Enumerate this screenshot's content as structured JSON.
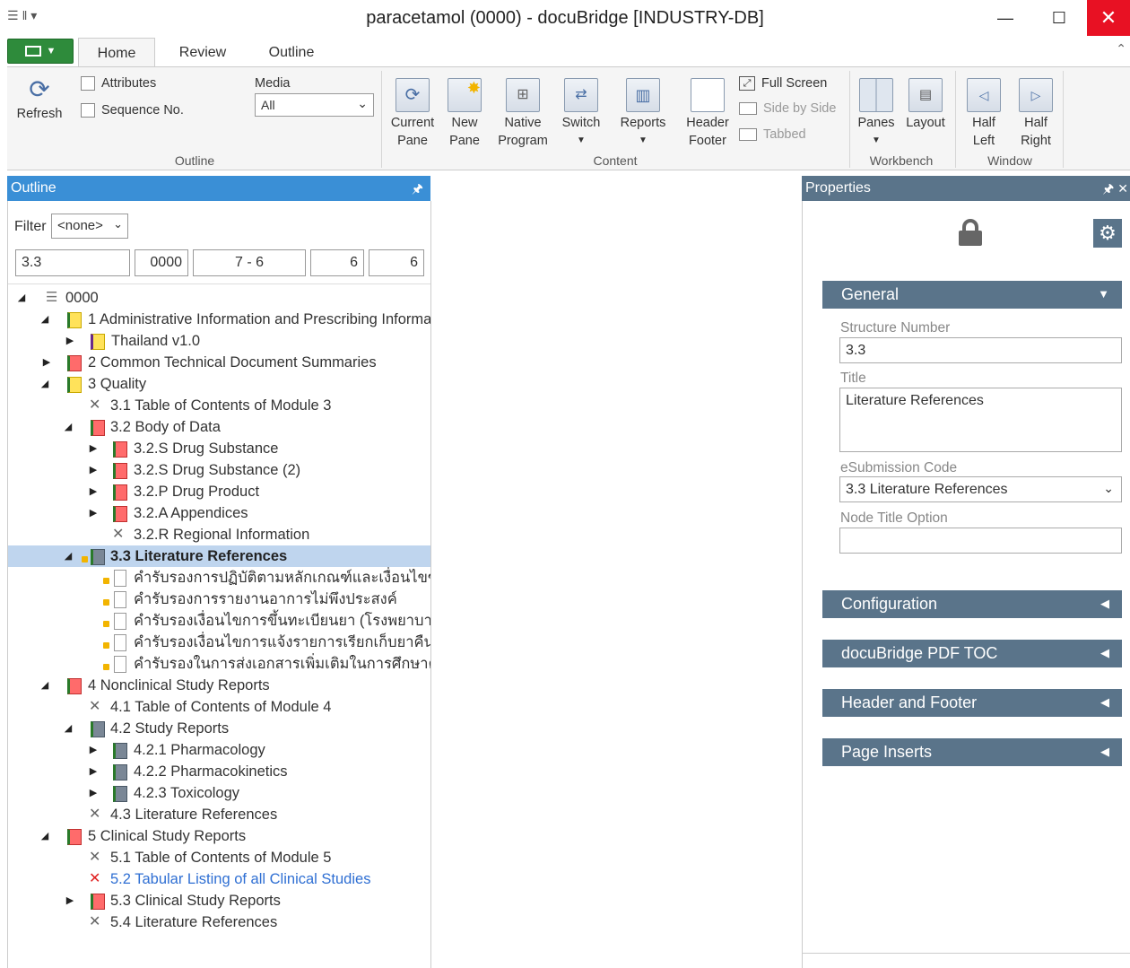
{
  "window": {
    "title": "paracetamol (0000) - docuBridge [INDUSTRY-DB]",
    "minimize": "—",
    "maximize": "☐",
    "close": "✕"
  },
  "ribbon": {
    "tabs": [
      "Home",
      "Review",
      "Outline"
    ],
    "outline_group": {
      "refresh": "Refresh",
      "attributes": "Attributes",
      "sequence_no": "Sequence No.",
      "media_label": "Media",
      "media_value": "All",
      "label": "Outline"
    },
    "content_group": {
      "current_pane": [
        "Current",
        "Pane"
      ],
      "new_pane": [
        "New",
        "Pane"
      ],
      "native_program": [
        "Native",
        "Program"
      ],
      "switch": "Switch",
      "reports": "Reports",
      "header_footer": [
        "Header",
        "Footer"
      ],
      "full_screen": "Full Screen",
      "side_by_side": "Side by Side",
      "tabbed": "Tabbed",
      "label": "Content"
    },
    "workbench_group": {
      "panes": "Panes",
      "layout": "Layout",
      "label": "Workbench"
    },
    "window_group": {
      "half_left": [
        "Half",
        "Left"
      ],
      "half_right": [
        "Half",
        "Right"
      ],
      "label": "Window"
    }
  },
  "outline": {
    "title": "Outline",
    "pin": "🖈",
    "filter_label": "Filter",
    "filter_value": "<none>",
    "seq_fields": [
      "3.3",
      "0000",
      "7 - 6",
      "6",
      "6"
    ],
    "tree": [
      {
        "label": "0000"
      },
      {
        "label": "1 Administrative Information and Prescribing Informa"
      },
      {
        "label": "Thailand v1.0"
      },
      {
        "label": "2 Common Technical Document Summaries"
      },
      {
        "label": "3 Quality"
      },
      {
        "label": "3.1 Table of Contents of Module 3"
      },
      {
        "label": "3.2 Body of Data"
      },
      {
        "label": "3.2.S Drug Substance"
      },
      {
        "label": "3.2.S Drug Substance (2)"
      },
      {
        "label": "3.2.P Drug Product"
      },
      {
        "label": "3.2.A Appendices"
      },
      {
        "label": "3.2.R Regional Information"
      },
      {
        "label": "3.3 Literature References"
      },
      {
        "label": "คำรับรองการปฏิบัติตามหลักเกณฑ์และเงื่อนไขของส"
      },
      {
        "label": "คำรับรองการรายงานอาการไม่พึงประสงค์"
      },
      {
        "label": "คำรับรองเงื่อนไขการขึ้นทะเบียนยา (โรงพยาบาล)"
      },
      {
        "label": "คำรับรองเงื่อนไขการแจ้งรายการเรียกเก็บยาคืน"
      },
      {
        "label": "คำรับรองในการส่งเอกสารเพิ่มเติมในการศึกษาความ"
      },
      {
        "label": "4 Nonclinical Study Reports"
      },
      {
        "label": "4.1 Table of Contents of Module 4"
      },
      {
        "label": "4.2 Study Reports"
      },
      {
        "label": "4.2.1 Pharmacology"
      },
      {
        "label": "4.2.2 Pharmacokinetics"
      },
      {
        "label": "4.2.3 Toxicology"
      },
      {
        "label": "4.3 Literature References"
      },
      {
        "label": "5 Clinical Study Reports"
      },
      {
        "label": "5.1 Table of Contents of Module 5"
      },
      {
        "label": "5.2 Tabular Listing of all Clinical Studies"
      },
      {
        "label": "5.3 Clinical Study Reports"
      },
      {
        "label": "5.4 Literature References"
      }
    ]
  },
  "properties": {
    "title": "Properties",
    "pin": "🖈 ✕",
    "general_section": "General",
    "structure_number_label": "Structure Number",
    "structure_number_value": "3.3",
    "title_label": "Title",
    "title_value": "Literature References",
    "esub_code_label": "eSubmission Code",
    "esub_code_value": "3.3 Literature References",
    "node_title_option_label": "Node Title Option",
    "node_title_option_value": "",
    "sections": [
      "Configuration",
      "docuBridge PDF TOC",
      "Header and Footer",
      "Page Inserts"
    ]
  },
  "colors": {
    "outline_header": "#3a8fd6",
    "properties_header": "#5a748a",
    "section_bar": "#5a748a",
    "selection": "#bfd5ee",
    "close_button": "#e81123",
    "file_button": "#2e8b3b",
    "link_text": "#2f6fd3"
  }
}
